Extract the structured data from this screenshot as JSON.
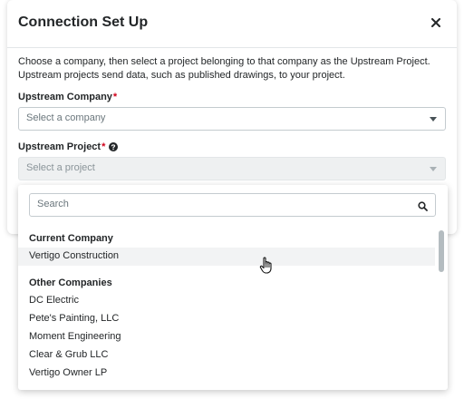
{
  "modal": {
    "title": "Connection Set Up",
    "close_symbol": "×",
    "description": "Choose a company, then select a project belonging to that company as the Upstream Project. Upstream projects send data, such as published drawings, to your project."
  },
  "fields": {
    "company": {
      "label": "Upstream Company",
      "required_mark": "*",
      "placeholder": "Select a company"
    },
    "project": {
      "label": "Upstream Project",
      "required_mark": "*",
      "placeholder": "Select a project",
      "help_icon": "question-circle-icon"
    }
  },
  "dropdown": {
    "search_placeholder": "Search",
    "search_icon": "magnifier-icon",
    "groups": [
      {
        "header": "Current Company",
        "options": [
          "Vertigo Construction"
        ]
      },
      {
        "header": "Other Companies",
        "options": [
          "DC Electric",
          "Pete's Painting, LLC",
          "Moment Engineering",
          "Clear & Grub LLC",
          "Vertigo Owner LP"
        ]
      }
    ],
    "highlighted_option": "Vertigo Construction"
  },
  "colors": {
    "required": "#d0021b",
    "highlight": "#f2f3f4",
    "text": "#232628",
    "placeholder": "#6a767c"
  }
}
